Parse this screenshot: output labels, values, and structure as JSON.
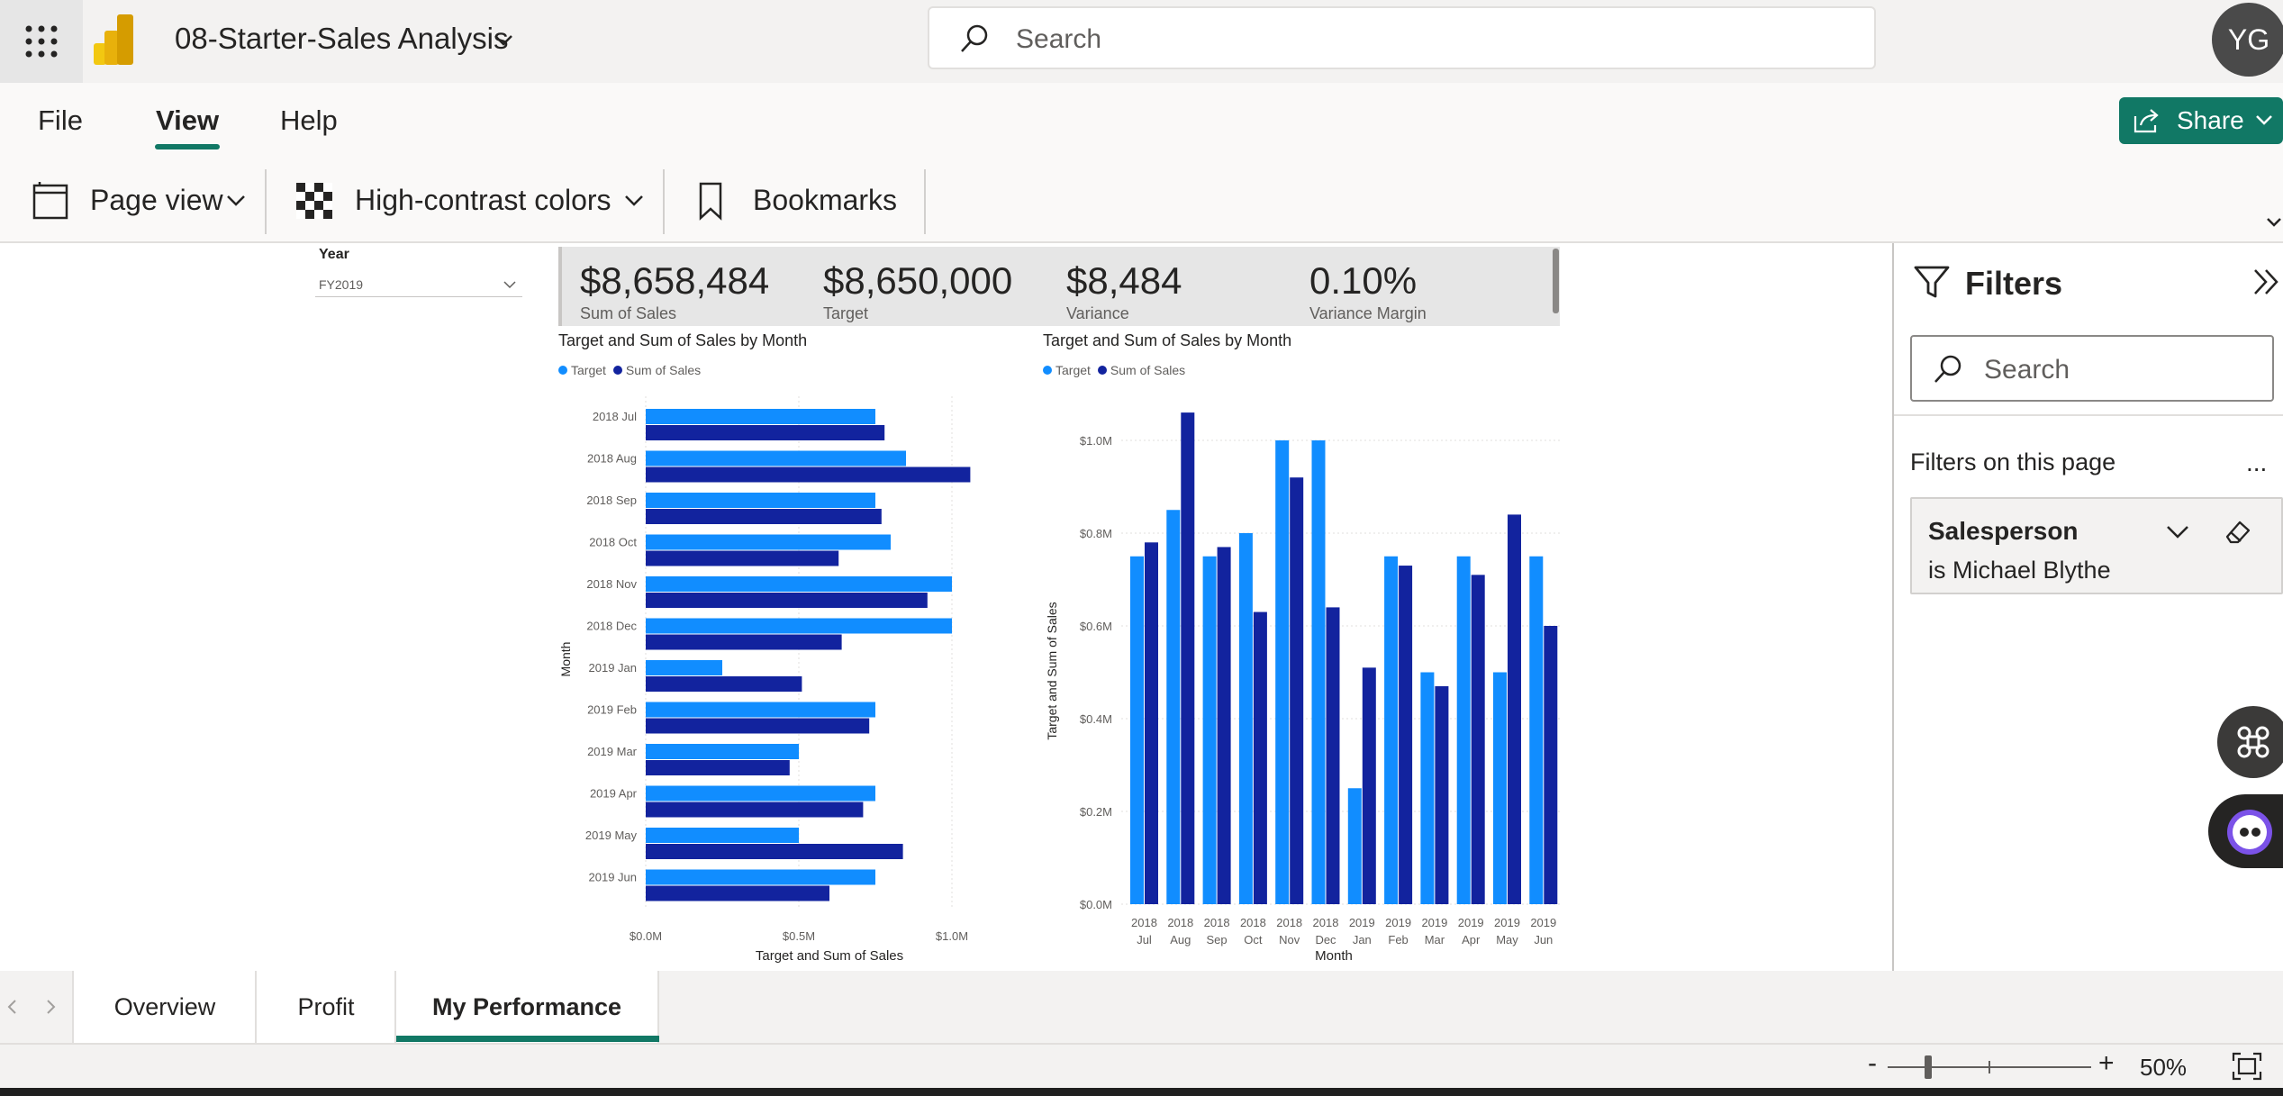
{
  "header": {
    "report_title": "08-Starter-Sales Analysis",
    "search_placeholder": "Search",
    "avatar_initials": "YG"
  },
  "menu": {
    "items": [
      "File",
      "View",
      "Help"
    ],
    "active": "View",
    "share_label": "Share"
  },
  "toolbar": {
    "page_view": "Page view",
    "high_contrast": "High-contrast colors",
    "bookmarks": "Bookmarks"
  },
  "slicer": {
    "label": "Year",
    "value": "FY2019"
  },
  "kpis": [
    {
      "value": "$8,658,484",
      "label": "Sum of Sales"
    },
    {
      "value": "$8,650,000",
      "label": "Target"
    },
    {
      "value": "$8,484",
      "label": "Variance"
    },
    {
      "value": "0.10%",
      "label": "Variance Margin"
    }
  ],
  "colors": {
    "target": "#118DFF",
    "sales": "#12239E",
    "accent": "#117865"
  },
  "chart_data": [
    {
      "type": "bar",
      "orientation": "horizontal",
      "title": "Target and Sum of Sales by Month",
      "categories": [
        "2018 Jul",
        "2018 Aug",
        "2018 Sep",
        "2018 Oct",
        "2018 Nov",
        "2018 Dec",
        "2019 Jan",
        "2019 Feb",
        "2019 Mar",
        "2019 Apr",
        "2019 May",
        "2019 Jun"
      ],
      "series": [
        {
          "name": "Target",
          "values": [
            0.75,
            0.85,
            0.75,
            0.8,
            1.0,
            1.0,
            0.25,
            0.75,
            0.5,
            0.75,
            0.5,
            0.75
          ]
        },
        {
          "name": "Sum of Sales",
          "values": [
            0.78,
            1.06,
            0.77,
            0.63,
            0.92,
            0.64,
            0.51,
            0.73,
            0.47,
            0.71,
            0.84,
            0.6
          ]
        }
      ],
      "xlabel": "Target and Sum of Sales",
      "ylabel": "Month",
      "xlim": [
        0,
        1.0
      ],
      "xticks": [
        "$0.0M",
        "$0.5M",
        "$1.0M"
      ],
      "legend": "top-left"
    },
    {
      "type": "bar",
      "orientation": "vertical",
      "title": "Target and Sum of Sales by Month",
      "categories": [
        "2018 Jul",
        "2018 Aug",
        "2018 Sep",
        "2018 Oct",
        "2018 Nov",
        "2018 Dec",
        "2019 Jan",
        "2019 Feb",
        "2019 Mar",
        "2019 Apr",
        "2019 May",
        "2019 Jun"
      ],
      "series": [
        {
          "name": "Target",
          "values": [
            0.75,
            0.85,
            0.75,
            0.8,
            1.0,
            1.0,
            0.25,
            0.75,
            0.5,
            0.75,
            0.5,
            0.75
          ]
        },
        {
          "name": "Sum of Sales",
          "values": [
            0.78,
            1.06,
            0.77,
            0.63,
            0.92,
            0.64,
            0.51,
            0.73,
            0.47,
            0.71,
            0.84,
            0.6
          ]
        }
      ],
      "xlabel": "Month",
      "ylabel": "Target and Sum of Sales",
      "ylim": [
        0,
        1.0
      ],
      "yticks": [
        "$0.0M",
        "$0.2M",
        "$0.4M",
        "$0.6M",
        "$0.8M",
        "$1.0M"
      ],
      "legend": "top-left"
    }
  ],
  "filters": {
    "title": "Filters",
    "search_placeholder": "Search",
    "section": "Filters on this page",
    "more": "...",
    "card": {
      "field": "Salesperson",
      "value": "is Michael Blythe"
    }
  },
  "pages": {
    "tabs": [
      "Overview",
      "Profit",
      "My Performance"
    ],
    "active": "My Performance"
  },
  "status": {
    "zoom_minus": "-",
    "zoom_plus": "+",
    "zoom": "50%",
    "zoom_fraction": 0.2
  }
}
